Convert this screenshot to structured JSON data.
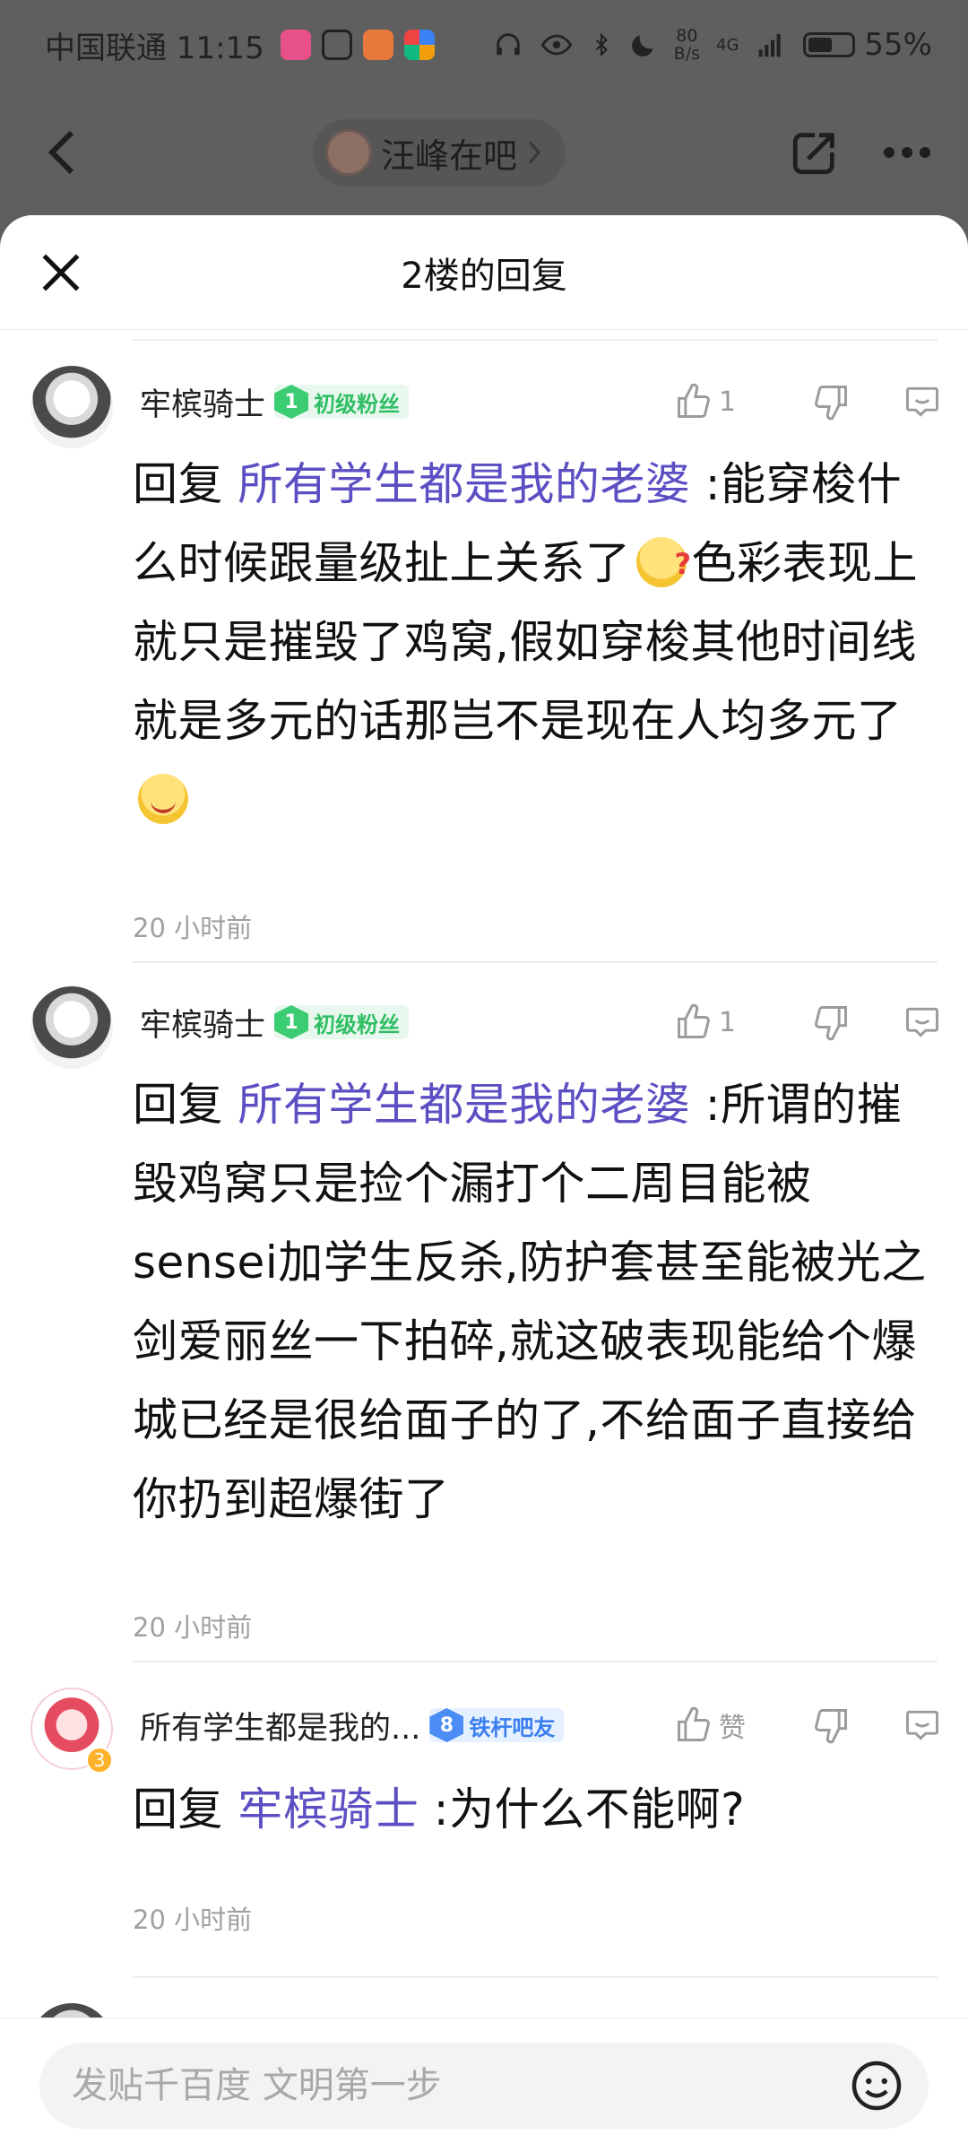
{
  "status_bar": {
    "carrier_time": "中国联通 11:15",
    "speed_value": "80",
    "speed_unit": "B/s",
    "network": "4G",
    "battery": "55%",
    "battery_level": 0.55
  },
  "nav": {
    "forum_name": "汪峰在吧"
  },
  "sheet": {
    "title": "2楼的回复"
  },
  "posts": [
    {
      "username": "牢槟骑士",
      "fan_level": "1",
      "fan_badge": "初级粉丝",
      "like_count": "1",
      "reply_prefix": "回复",
      "mention": "所有学生都是我的老婆",
      "text_part1": " :能穿梭什么时候跟量级扯上关系了",
      "text_part2": "色彩表现上就只是摧毁了鸡窝,假如穿梭其他时间线就是多元的话那岂不是现在人均多元了",
      "time": "20 小时前"
    },
    {
      "username": "牢槟骑士",
      "fan_level": "1",
      "fan_badge": "初级粉丝",
      "like_count": "1",
      "reply_prefix": "回复",
      "mention": "所有学生都是我的老婆",
      "text": " :所谓的摧毁鸡窝只是捡个漏打个二周目能被sensei加学生反杀,防护套甚至能被光之剑爱丽丝一下拍碎,就这破表现能给个爆城已经是很给面子的了,不给面子直接给你扔到超爆街了",
      "time": "20 小时前"
    },
    {
      "username": "所有学生都是我的...",
      "avatar_level": "3",
      "fan_level": "8",
      "fan_badge": "铁杆吧友",
      "like_label": "赞",
      "reply_prefix": "回复",
      "mention": "牢槟骑士",
      "text": " :为什么不能啊?",
      "time": "20 小时前"
    }
  ],
  "input": {
    "placeholder": "发贴千百度 文明第一步"
  },
  "icons": {
    "back": "chevron-left-icon",
    "share": "share-icon",
    "more": "more-icon",
    "close": "close-icon",
    "like": "thumbs-up-icon",
    "dislike": "thumbs-down-icon",
    "reply": "comment-icon",
    "emoji": "emoji-icon"
  },
  "colors": {
    "mention": "#5b4fc3",
    "fan_green": "#3ccc74",
    "fan_blue": "#4b8df5"
  }
}
